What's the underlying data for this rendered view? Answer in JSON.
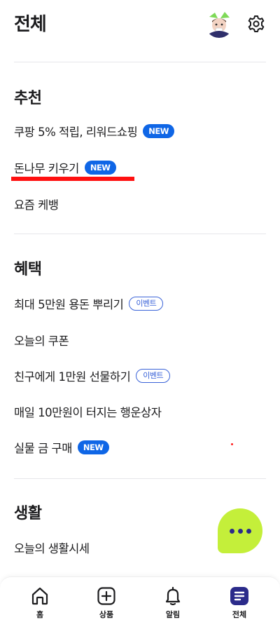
{
  "header": {
    "title": "전체"
  },
  "sections": [
    {
      "title": "추천",
      "items": [
        {
          "label": "쿠팡 5% 적립, 리워드쇼핑",
          "badge": "NEW"
        },
        {
          "label": "돈나무 키우기",
          "badge": "NEW"
        },
        {
          "label": "요즘 케뱅"
        }
      ]
    },
    {
      "title": "혜택",
      "items": [
        {
          "label": "최대 5만원 용돈 뿌리기",
          "badge": "이벤트"
        },
        {
          "label": "오늘의 쿠폰"
        },
        {
          "label": "친구에게 1만원 선물하기",
          "badge": "이벤트"
        },
        {
          "label": "매일 10만원이 터지는 행운상자"
        },
        {
          "label": "실물 금 구매",
          "badge": "NEW"
        }
      ]
    },
    {
      "title": "생활",
      "items": [
        {
          "label": "오늘의 생활시세"
        }
      ]
    }
  ],
  "bottom_nav": [
    {
      "label": "홈",
      "icon": "home-icon"
    },
    {
      "label": "상품",
      "icon": "plus-square-icon"
    },
    {
      "label": "알림",
      "icon": "bell-icon"
    },
    {
      "label": "전체",
      "icon": "menu-icon",
      "active": true
    }
  ],
  "colors": {
    "new_badge": "#0f66e6",
    "event_badge": "#3a63d8",
    "fab": "#c4ef3a",
    "active_nav": "#2b2b8a",
    "annotation": "#ff1010"
  }
}
